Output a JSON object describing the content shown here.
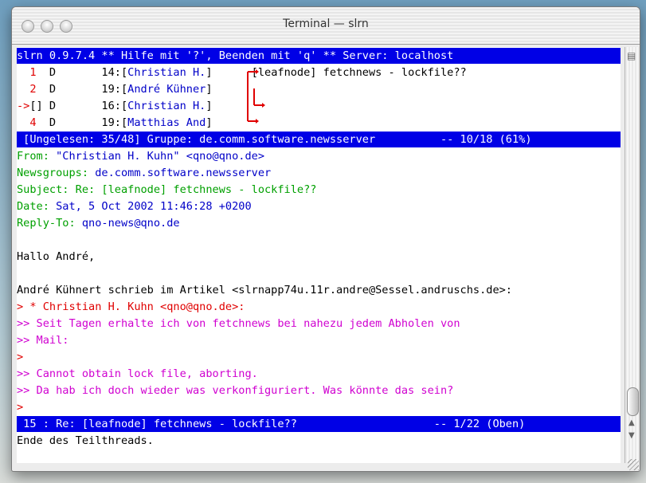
{
  "window": {
    "title": "Terminal — slrn"
  },
  "colors": {
    "status_bar_bg": "#0000e6",
    "status_bar_text": "#ffffff",
    "header_label": "#00a000",
    "header_value": "#0000c8",
    "quote_level1": "#e00000",
    "quote_level2": "#d000d0",
    "article_number": "#e00000",
    "tree": "#e00000"
  },
  "lines": [
    {
      "segments": [
        {
          "t": "slrn 0.9.7.4 ** Hilfe mit '?', Beenden mit 'q' ** Server: localhost",
          "c": "#ffffff"
        }
      ],
      "bar": true
    },
    {
      "segments": [
        {
          "t": "  1",
          "c": "#e00000"
        },
        {
          "t": "  D       14:[",
          "c": "#000000"
        },
        {
          "t": "Christian H.",
          "c": "#0000c8"
        },
        {
          "t": "]      [leafnode] fetchnews - lockfile??",
          "c": "#000000"
        }
      ]
    },
    {
      "segments": [
        {
          "t": "  2",
          "c": "#e00000"
        },
        {
          "t": "  D       19:[",
          "c": "#000000"
        },
        {
          "t": "André Kühner",
          "c": "#0000c8"
        },
        {
          "t": "]",
          "c": "#000000"
        }
      ]
    },
    {
      "segments": [
        {
          "t": "->",
          "c": "#e00000"
        },
        {
          "t": "[] D       16:[",
          "c": "#000000"
        },
        {
          "t": "Christian H.",
          "c": "#0000c8"
        },
        {
          "t": "]",
          "c": "#000000"
        }
      ]
    },
    {
      "segments": [
        {
          "t": "  4",
          "c": "#e00000"
        },
        {
          "t": "  D       19:[",
          "c": "#000000"
        },
        {
          "t": "Matthias And",
          "c": "#0000c8"
        },
        {
          "t": "]",
          "c": "#000000"
        }
      ]
    },
    {
      "segments": [
        {
          "t": " [Ungelesen: 35/48] Gruppe: de.comm.software.newsserver          -- 10/18 (61%)",
          "c": "#ffffff"
        }
      ],
      "bar": true
    },
    {
      "segments": [
        {
          "t": "From: ",
          "c": "#00a000"
        },
        {
          "t": "\"Christian H. Kuhn\" <qno@qno.de>",
          "c": "#0000c8"
        }
      ]
    },
    {
      "segments": [
        {
          "t": "Newsgroups: ",
          "c": "#00a000"
        },
        {
          "t": "de.comm.software.newsserver",
          "c": "#0000c8"
        }
      ]
    },
    {
      "segments": [
        {
          "t": "Subject: Re: [leafnode] fetchnews - lockfile??",
          "c": "#00a000"
        }
      ]
    },
    {
      "segments": [
        {
          "t": "Date: ",
          "c": "#00a000"
        },
        {
          "t": "Sat, 5 Oct 2002 11:46:28 +0200",
          "c": "#0000c8"
        }
      ]
    },
    {
      "segments": [
        {
          "t": "Reply-To: ",
          "c": "#00a000"
        },
        {
          "t": "qno-news@qno.de",
          "c": "#0000c8"
        }
      ]
    },
    {
      "segments": [
        {
          "t": "",
          "c": "#000000"
        }
      ]
    },
    {
      "segments": [
        {
          "t": "Hallo André,",
          "c": "#000000"
        }
      ]
    },
    {
      "segments": [
        {
          "t": "",
          "c": "#000000"
        }
      ]
    },
    {
      "segments": [
        {
          "t": "André Kühnert schrieb im Artikel <slrnapp74u.11r.andre@Sessel.andruschs.de>:",
          "c": "#000000"
        }
      ]
    },
    {
      "segments": [
        {
          "t": "> * Christian H. Kuhn <qno@qno.de>:",
          "c": "#e00000"
        }
      ]
    },
    {
      "segments": [
        {
          "t": ">> Seit Tagen erhalte ich von fetchnews bei nahezu jedem Abholen von",
          "c": "#d000d0"
        }
      ]
    },
    {
      "segments": [
        {
          "t": ">> Mail:",
          "c": "#d000d0"
        }
      ]
    },
    {
      "segments": [
        {
          "t": ">",
          "c": "#e00000"
        }
      ]
    },
    {
      "segments": [
        {
          "t": ">> Cannot obtain lock file, aborting.",
          "c": "#d000d0"
        }
      ]
    },
    {
      "segments": [
        {
          "t": ">> Da hab ich doch wieder was verkonfiguriert. Was könnte das sein?",
          "c": "#d000d0"
        }
      ]
    },
    {
      "segments": [
        {
          "t": ">",
          "c": "#e00000"
        }
      ]
    },
    {
      "segments": [
        {
          "t": " 15 : Re: [leafnode] fetchnews - lockfile??                     -- 1/22 (Oben)",
          "c": "#ffffff"
        }
      ],
      "bar": true
    },
    {
      "segments": [
        {
          "t": "Ende des Teilthreads.",
          "c": "#000000"
        }
      ]
    }
  ]
}
